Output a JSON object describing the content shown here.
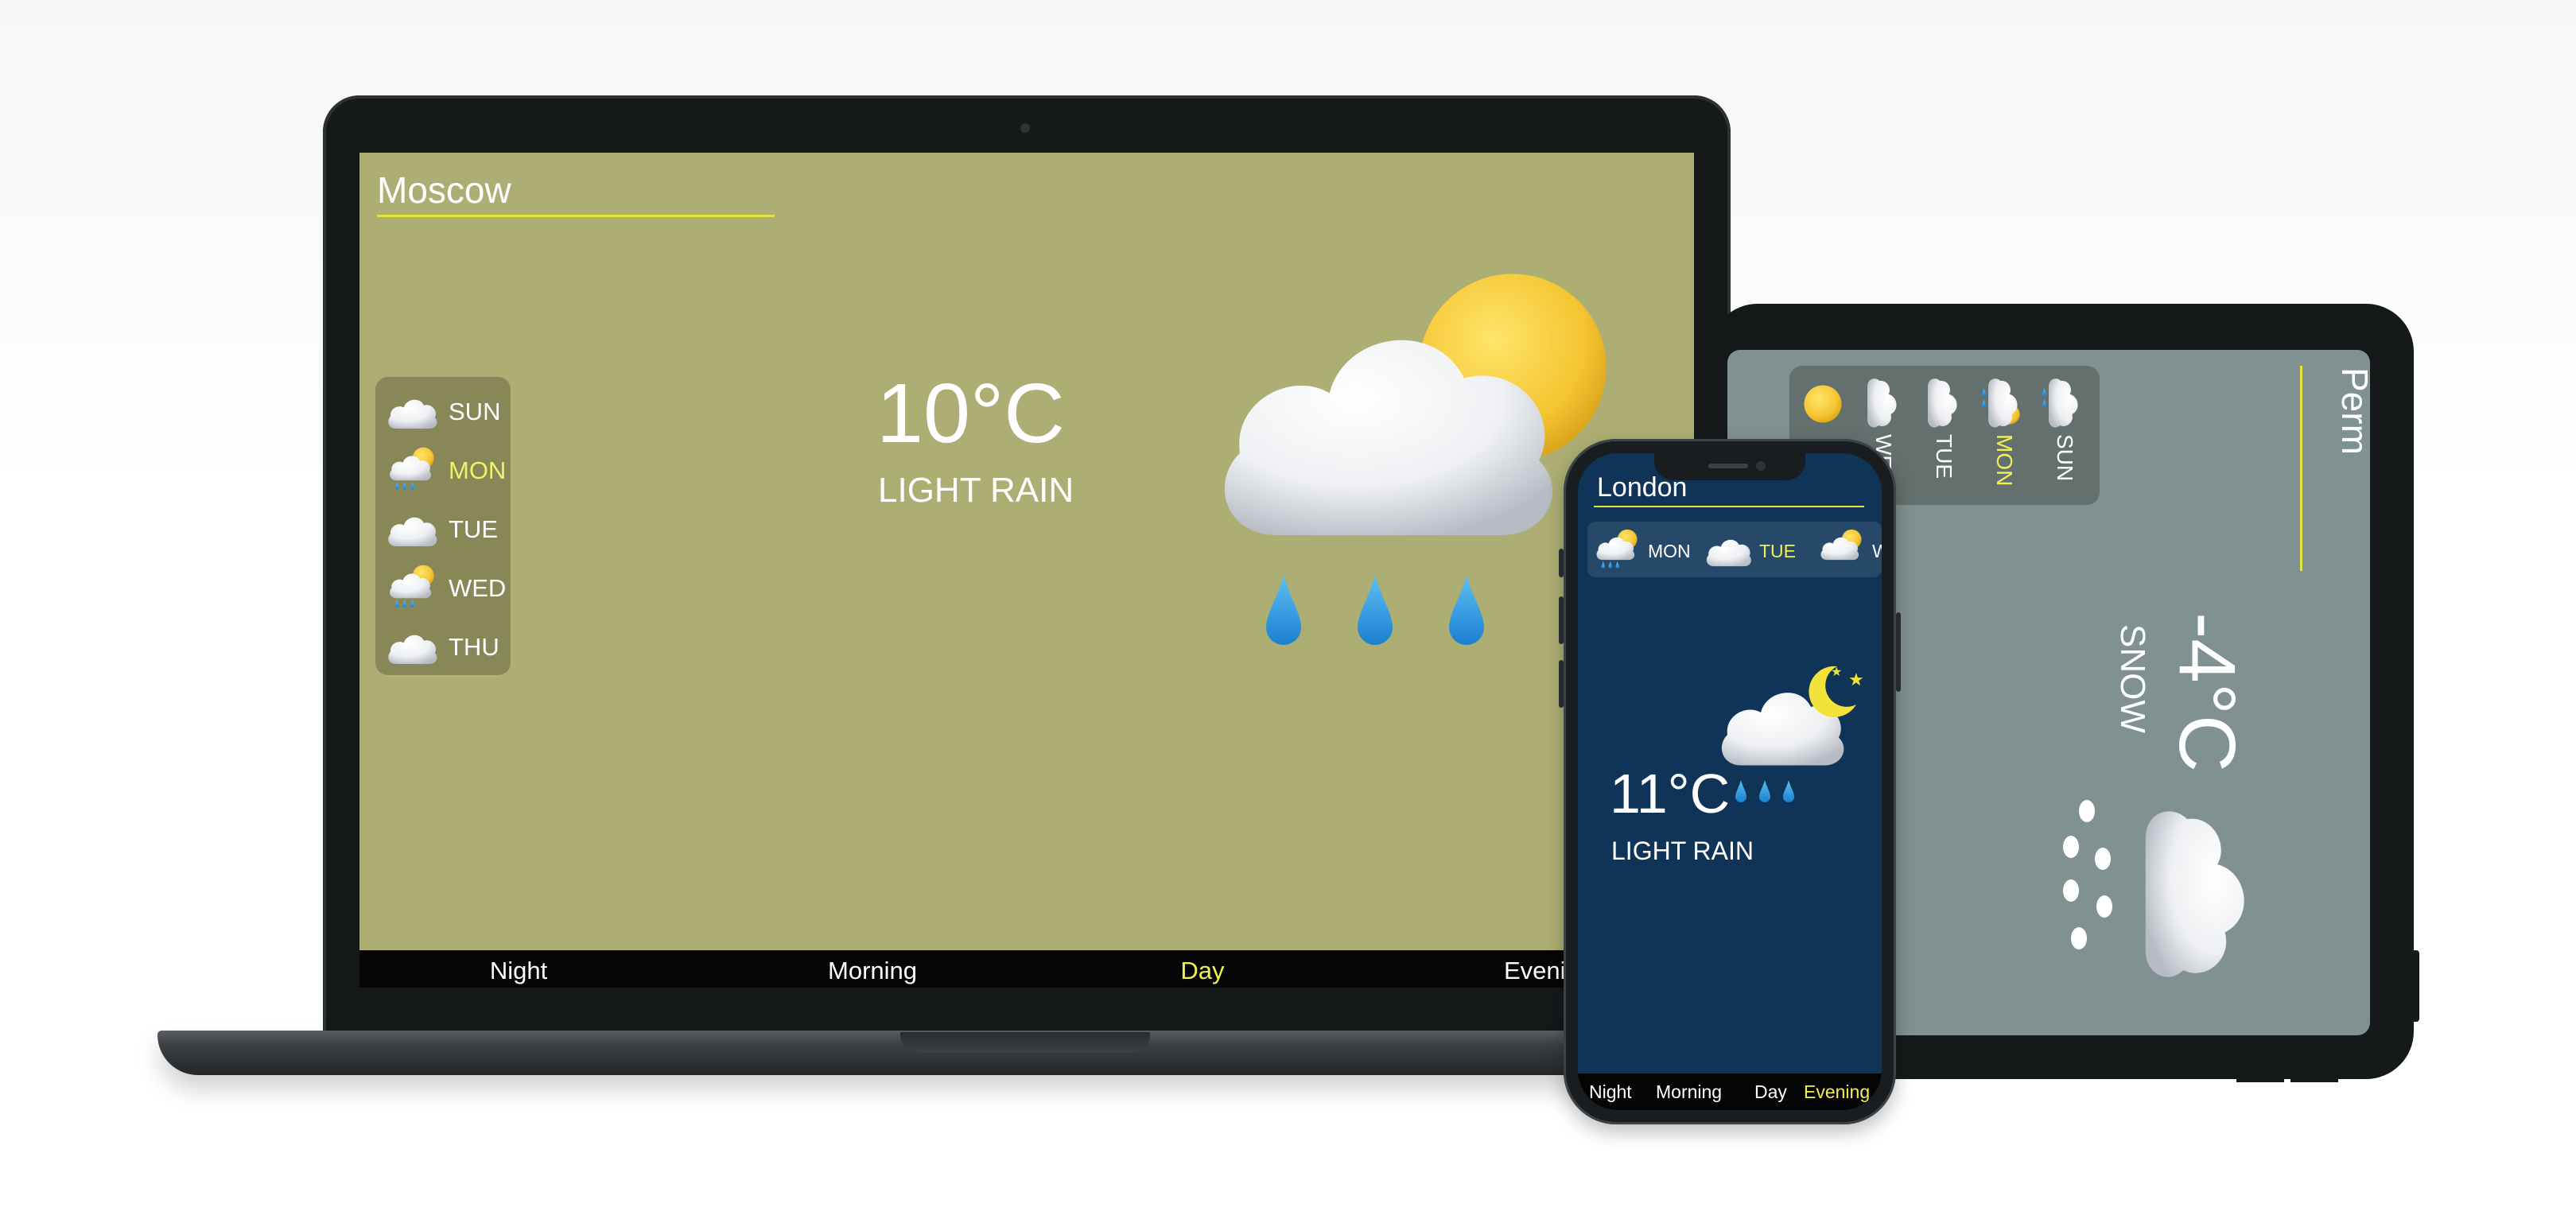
{
  "laptop": {
    "city": "Moscow",
    "temperature": "10°C",
    "condition": "LIGHT RAIN",
    "days": [
      {
        "label": "SUN",
        "icon": "cloud-icon",
        "active": false
      },
      {
        "label": "MON",
        "icon": "sun-cloud-rain-icon",
        "active": true
      },
      {
        "label": "TUE",
        "icon": "cloud-icon",
        "active": false
      },
      {
        "label": "WED",
        "icon": "sun-cloud-rain-icon",
        "active": false
      },
      {
        "label": "THU",
        "icon": "cloud-icon",
        "active": false
      }
    ],
    "periods": [
      {
        "label": "Night",
        "active": false
      },
      {
        "label": "Morning",
        "active": false
      },
      {
        "label": "Day",
        "active": true
      },
      {
        "label": "Evening",
        "active": false
      }
    ],
    "main_icon": "sun-cloud-rain-icon"
  },
  "tablet": {
    "city": "Perm",
    "temperature": "-4°C",
    "condition": "SNOW",
    "days": [
      {
        "label": "",
        "icon": "sun-icon",
        "active": false
      },
      {
        "label": "WE",
        "icon": "cloud-icon",
        "active": false
      },
      {
        "label": "TUE",
        "icon": "cloud-icon",
        "active": false
      },
      {
        "label": "MON",
        "icon": "sun-cloud-rain-icon",
        "active": true
      },
      {
        "label": "SUN",
        "icon": "cloud-rain-icon",
        "active": false
      }
    ],
    "main_icon": "snow-cloud-icon"
  },
  "phone": {
    "city": "London",
    "temperature": "11°C",
    "condition": "LIGHT RAIN",
    "days": [
      {
        "label": "MON",
        "icon": "sun-cloud-rain-icon",
        "active": false
      },
      {
        "label": "TUE",
        "icon": "cloud-icon",
        "active": true
      },
      {
        "label": "W",
        "icon": "sun-cloud-icon",
        "active": false
      }
    ],
    "periods": [
      {
        "label": "Night",
        "active": false
      },
      {
        "label": "Morning",
        "active": false
      },
      {
        "label": "Day",
        "active": false
      },
      {
        "label": "Evening",
        "active": true
      }
    ],
    "main_icon": "moon-cloud-rain-icon"
  },
  "colors": {
    "laptop_bg": "#acae73",
    "tablet_bg": "#7f9190",
    "phone_bg": "#0f3458",
    "accent_yellow": "#f1ee5c",
    "underline_yellow": "#e4e43a",
    "sun": "#f4c430",
    "rain": "#2f9be0"
  }
}
